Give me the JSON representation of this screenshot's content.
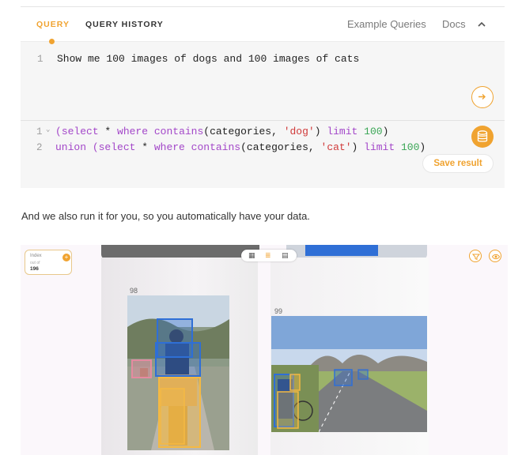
{
  "tabs": {
    "query": "QUERY",
    "query_history": "QUERY HISTORY",
    "example_queries": "Example Queries",
    "docs": "Docs"
  },
  "natural_query": {
    "line_number": "1",
    "text": "Show me 100 images of dogs and 100 images of cats"
  },
  "sql": {
    "line1": {
      "number": "1",
      "tokens": [
        "(",
        "select",
        " * ",
        "where",
        " ",
        "contains",
        "(categories, ",
        "'dog'",
        ") ",
        "limit",
        " ",
        "100",
        ")"
      ]
    },
    "line2": {
      "number": "2",
      "tokens": [
        "union",
        " (",
        "select",
        " * ",
        "where",
        " ",
        "contains",
        "(categories, ",
        "'cat'",
        ") ",
        "limit",
        " ",
        "100",
        ")"
      ]
    }
  },
  "buttons": {
    "save_result": "Save result"
  },
  "paragraph": "And we also run it for you, so you automatically have your data.",
  "viewer": {
    "index_label": "Index",
    "index_out_of": "out of",
    "index_value": "196",
    "images": [
      {
        "label": "98"
      },
      {
        "label": "99"
      }
    ]
  },
  "colors": {
    "accent": "#f0a330",
    "keyword": "#a347c9",
    "string": "#d03a3a",
    "number": "#3aa655",
    "box_person": "#2f6fd6",
    "box_dog": "#f5b942",
    "box_cat": "#e58aa0"
  },
  "icons": [
    "chevron-up-icon",
    "arrow-right-icon",
    "database-icon",
    "grid-icon",
    "list-icon",
    "rows-icon",
    "filter-icon",
    "eye-icon",
    "plus-icon"
  ]
}
